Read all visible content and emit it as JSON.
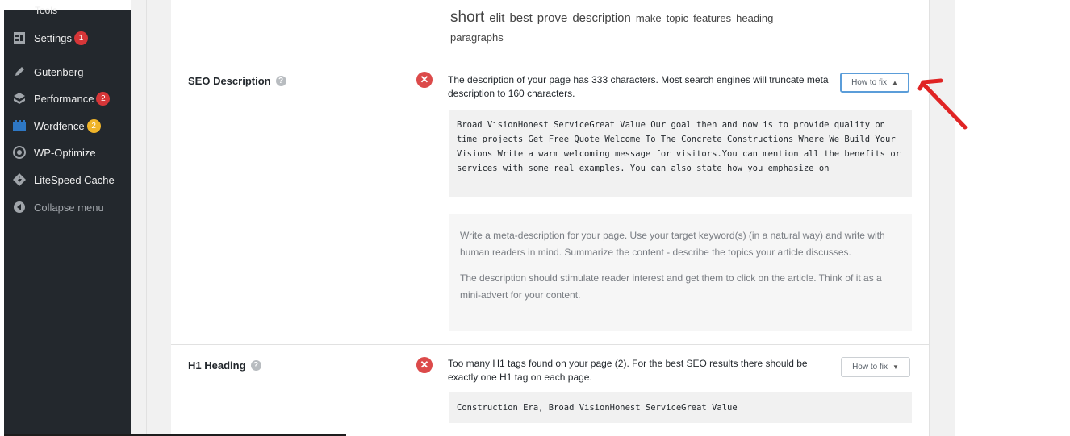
{
  "sidebar": {
    "partial_label": "Tools",
    "items": [
      {
        "label": "Settings",
        "icon": "settings-icon",
        "badge": "1",
        "badge_color": "#d63638"
      },
      {
        "label": "Gutenberg",
        "icon": "pencil-icon",
        "badge": null
      },
      {
        "label": "Performance",
        "icon": "performance-icon",
        "badge": "2",
        "badge_color": "#d63638"
      },
      {
        "label": "Wordfence",
        "icon": "wordfence-icon",
        "badge": "2",
        "badge_color": "#f0b429"
      },
      {
        "label": "WP-Optimize",
        "icon": "optimize-icon",
        "badge": null
      },
      {
        "label": "LiteSpeed Cache",
        "icon": "litespeed-icon",
        "badge": null
      },
      {
        "label": "Collapse menu",
        "icon": "collapse-icon",
        "badge": null
      }
    ]
  },
  "keywords": [
    {
      "word": "short",
      "size": 19
    },
    {
      "word": "elit",
      "size": 15
    },
    {
      "word": "best",
      "size": 15
    },
    {
      "word": "prove",
      "size": 15
    },
    {
      "word": "description",
      "size": 15
    },
    {
      "word": "make",
      "size": 13
    },
    {
      "word": "topic",
      "size": 13
    },
    {
      "word": "features",
      "size": 13
    },
    {
      "word": "heading",
      "size": 13
    },
    {
      "word": "paragraphs",
      "size": 13
    }
  ],
  "seo_description": {
    "label": "SEO Description",
    "status_icon": "error-icon",
    "message": "The description of your page has 333 characters. Most search engines will truncate meta description to 160 characters.",
    "fix_label": "How to fix",
    "fix_state": "expanded",
    "content": "Broad VisionHonest ServiceGreat Value Our goal then and now is to provide quality on time projects Get Free Quote Welcome To The Concrete Constructions Where We Build Your Visions Write a warm welcoming message for visitors.You can mention all the benefits or services with some real examples. You can also state how you emphasize on",
    "hint_1": "Write a meta-description for your page. Use your target keyword(s) (in a natural way) and write with human readers in mind. Summarize the content - describe the topics your article discusses.",
    "hint_2": "The description should stimulate reader interest and get them to click on the article. Think of it as a mini-advert for your content."
  },
  "h1_heading": {
    "label": "H1 Heading",
    "status_icon": "error-icon",
    "message": "Too many H1 tags found on your page (2). For the best SEO results there should be exactly one H1 tag on each page.",
    "fix_label": "How to fix",
    "fix_state": "collapsed",
    "content": "Construction Era, Broad VisionHonest ServiceGreat Value"
  },
  "colors": {
    "sidebar_bg": "#23282d",
    "error": "#dc4a4a",
    "annotation": "#e02424",
    "active_button_border": "#5b9dd9"
  }
}
